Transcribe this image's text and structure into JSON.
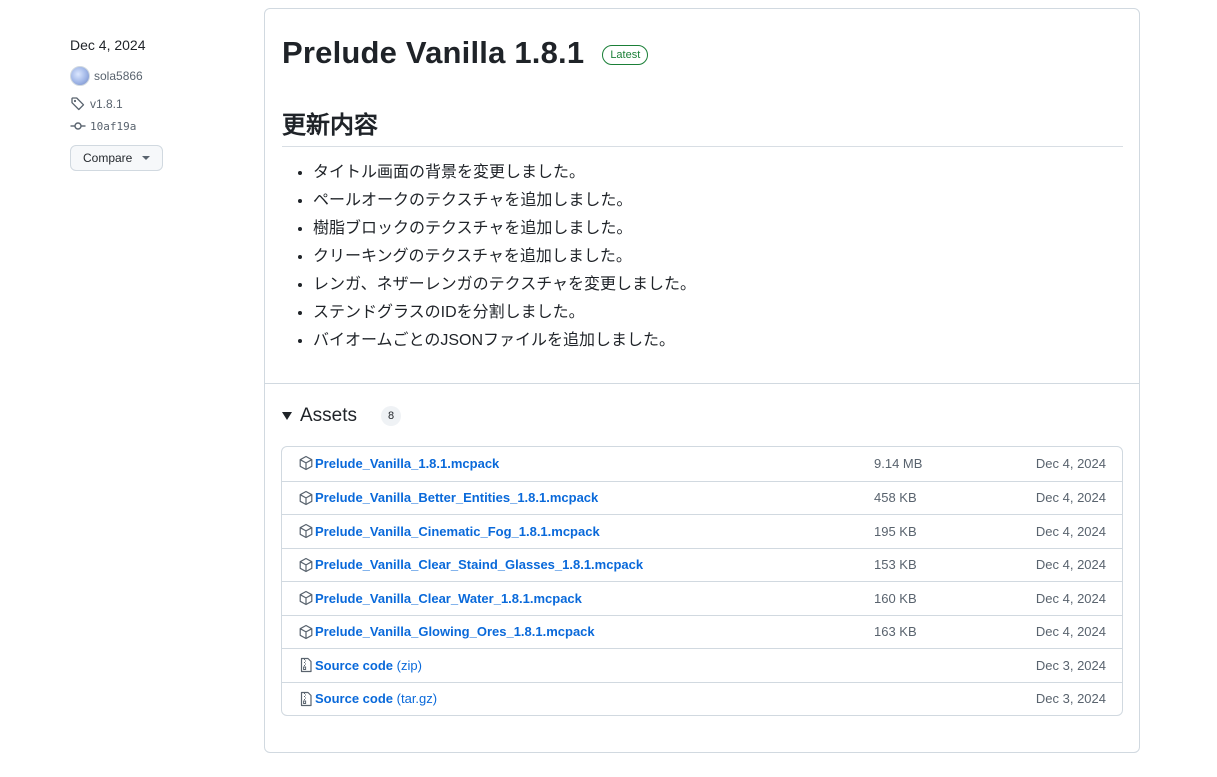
{
  "sidebar": {
    "date": "Dec 4, 2024",
    "author": "sola5866",
    "tag": "v1.8.1",
    "commit": "10af19a",
    "compare_label": "Compare"
  },
  "release": {
    "title": "Prelude Vanilla 1.8.1",
    "badge": "Latest",
    "notes_heading": "更新内容",
    "notes": [
      "タイトル画面の背景を変更しました。",
      "ペールオークのテクスチャを追加しました。",
      "樹脂ブロックのテクスチャを追加しました。",
      "クリーキングのテクスチャを追加しました。",
      "レンガ、ネザーレンガのテクスチャを変更しました。",
      "ステンドグラスのIDを分割しました。",
      "バイオームごとのJSONファイルを追加しました。"
    ]
  },
  "assets": {
    "title": "Assets",
    "count": "8",
    "items": [
      {
        "name": "Prelude_Vanilla_1.8.1.mcpack",
        "suffix": "",
        "size": "9.14 MB",
        "date": "Dec 4, 2024",
        "icon": "package-icon"
      },
      {
        "name": "Prelude_Vanilla_Better_Entities_1.8.1.mcpack",
        "suffix": "",
        "size": "458 KB",
        "date": "Dec 4, 2024",
        "icon": "package-icon"
      },
      {
        "name": "Prelude_Vanilla_Cinematic_Fog_1.8.1.mcpack",
        "suffix": "",
        "size": "195 KB",
        "date": "Dec 4, 2024",
        "icon": "package-icon"
      },
      {
        "name": "Prelude_Vanilla_Clear_Staind_Glasses_1.8.1.mcpack",
        "suffix": "",
        "size": "153 KB",
        "date": "Dec 4, 2024",
        "icon": "package-icon"
      },
      {
        "name": "Prelude_Vanilla_Clear_Water_1.8.1.mcpack",
        "suffix": "",
        "size": "160 KB",
        "date": "Dec 4, 2024",
        "icon": "package-icon"
      },
      {
        "name": "Prelude_Vanilla_Glowing_Ores_1.8.1.mcpack",
        "suffix": "",
        "size": "163 KB",
        "date": "Dec 4, 2024",
        "icon": "package-icon"
      },
      {
        "name": "Source code",
        "suffix": " (zip)",
        "size": "",
        "date": "Dec 3, 2024",
        "icon": "file-zip-icon"
      },
      {
        "name": "Source code",
        "suffix": " (tar.gz)",
        "size": "",
        "date": "Dec 3, 2024",
        "icon": "file-zip-icon"
      }
    ]
  }
}
